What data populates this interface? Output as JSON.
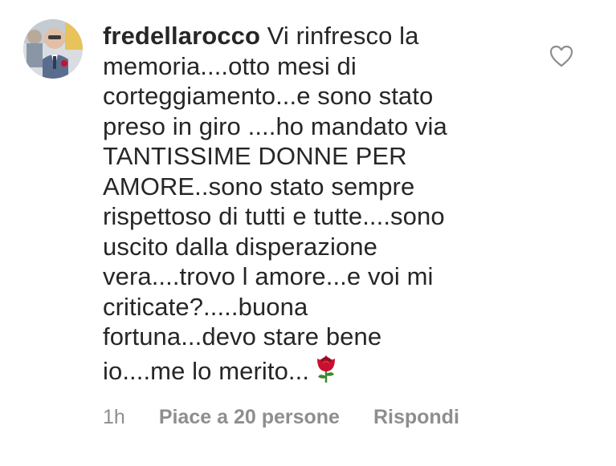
{
  "comment": {
    "username": "fredellarocco",
    "text": "Vi rinfresco la\nmemoria....otto mesi di\ncorteggiamento...e sono stato\npreso in giro ....ho mandato via\nTANTISSIME DONNE PER\nAMORE..sono stato sempre\nrispettoso di tutti e tutte....sono\nuscito dalla disperazione\nvera....trovo l amore...e voi mi\ncriticate?.....buona\nfortuna...devo stare bene\nio....me lo merito...",
    "emoji_icon": "rose-icon",
    "like_icon": "heart-outline-icon"
  },
  "meta": {
    "time": "1h",
    "likes": "Piace a 20 persone",
    "reply": "Rispondi"
  },
  "colors": {
    "text": "#262626",
    "secondary": "#8e8e8e",
    "rose": "#c8102e",
    "leaf": "#3a8a2e"
  }
}
